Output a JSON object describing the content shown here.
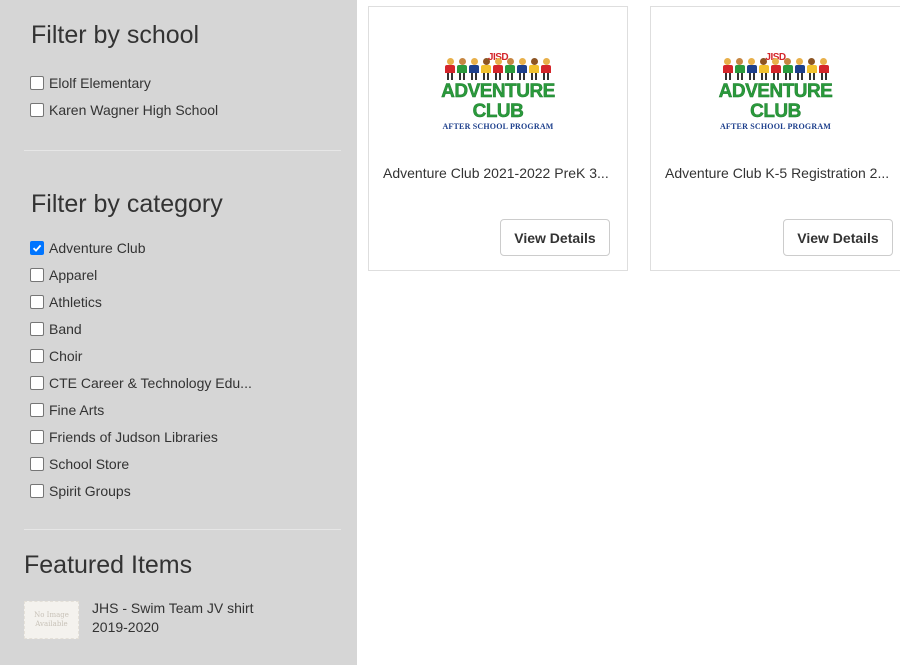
{
  "sidebar": {
    "school_filter": {
      "title": "Filter by school",
      "options": [
        {
          "label": "Elolf Elementary",
          "checked": false
        },
        {
          "label": "Karen Wagner High School",
          "checked": false
        }
      ]
    },
    "category_filter": {
      "title": "Filter by category",
      "options": [
        {
          "label": "Adventure Club",
          "checked": true
        },
        {
          "label": "Apparel",
          "checked": false
        },
        {
          "label": "Athletics",
          "checked": false
        },
        {
          "label": "Band",
          "checked": false
        },
        {
          "label": "Choir",
          "checked": false
        },
        {
          "label": "CTE Career & Technology Edu...",
          "checked": false
        },
        {
          "label": "Fine Arts",
          "checked": false
        },
        {
          "label": "Friends of Judson Libraries",
          "checked": false
        },
        {
          "label": "School Store",
          "checked": false
        },
        {
          "label": "Spirit Groups",
          "checked": false
        }
      ]
    },
    "featured": {
      "title": "Featured Items",
      "items": [
        {
          "label": "JHS - Swim Team JV shirt 2019-2020",
          "thumb_line1": "No Image",
          "thumb_line2": "Available"
        }
      ]
    }
  },
  "products": [
    {
      "title": "Adventure Club 2021-2022 PreK 3...",
      "button": "View Details",
      "logo": {
        "badge": "JISD",
        "main": "ADVENTURE CLUB",
        "sub": "AFTER SCHOOL PROGRAM"
      }
    },
    {
      "title": "Adventure Club K-5 Registration 2...",
      "button": "View Details",
      "logo": {
        "badge": "JISD",
        "main": "ADVENTURE CLUB",
        "sub": "AFTER SCHOOL PROGRAM"
      }
    }
  ],
  "colors": {
    "sidebar_bg": "#d6d6d6",
    "checkbox_checked": "#0075ff",
    "logo_green": "#2a9a3c",
    "logo_red": "#d4252a",
    "logo_blue": "#1d3f8c"
  }
}
